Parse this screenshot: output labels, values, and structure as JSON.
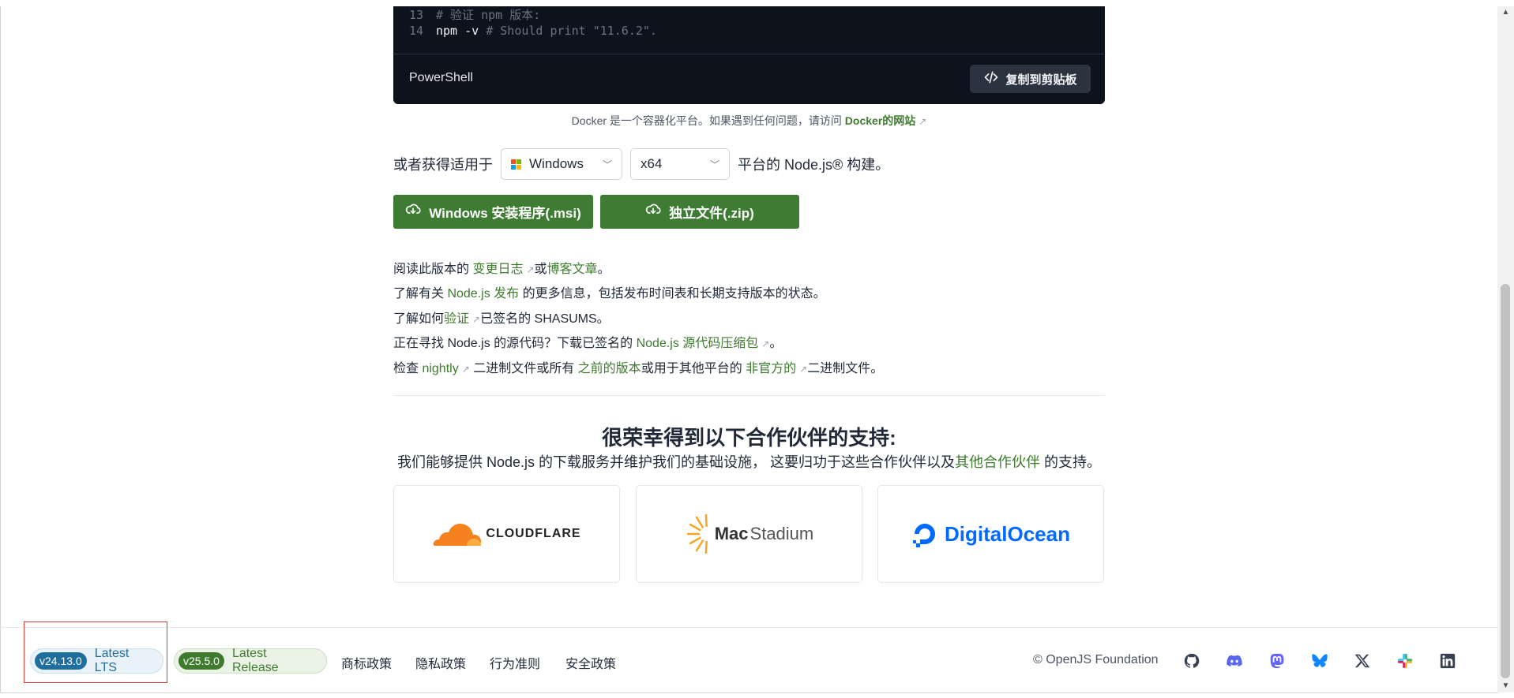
{
  "code": {
    "lines": [
      {
        "num": "13",
        "text": "# 验证 npm 版本:"
      },
      {
        "num": "14",
        "cmd": "npm -v",
        "comment": "# Should print \"11.6.2\"."
      }
    ],
    "language": "PowerShell",
    "copy_label": "复制到剪贴板"
  },
  "docker_note": {
    "text": "Docker 是一个容器化平台。如果遇到任何问题，请访问 ",
    "link": "Docker的网站"
  },
  "platform": {
    "prefix": "或者获得适用于",
    "os": "Windows",
    "arch": "x64",
    "suffix": "平台的 Node.js® 构建。"
  },
  "downloads": {
    "msi_label": "Windows 安装程序(.msi)",
    "zip_label": "独立文件(.zip)"
  },
  "info": {
    "l1": {
      "a": "阅读此版本的 ",
      "link1": "变更日志",
      "b": "或",
      "link2": "博客文章",
      "c": "。"
    },
    "l2": {
      "a": "了解有关 ",
      "link1": "Node.js 发布",
      "b": " 的更多信息，包括发布时间表和长期支持版本的状态。"
    },
    "l3": {
      "a": "了解如何",
      "link1": "验证",
      "b": "已签名的 SHASUMS。"
    },
    "l4": {
      "a": "正在寻找 Node.js 的源代码？下载已签名的 ",
      "link1": "Node.js 源代码压缩包",
      "b": "。"
    },
    "l5": {
      "a": "检查 ",
      "link1": "nightly",
      "b": " 二进制文件或所有 ",
      "link2": "之前的版本",
      "c": "或用于其他平台的 ",
      "link3": "非官方的",
      "d": "二进制文件。"
    }
  },
  "partners": {
    "title": "很荣幸得到以下合作伙伴的支持:",
    "subtitle_a": "我们能够提供 Node.js 的下载服务并维护我们的基础设施， 这要归功于这些合作伙伴以及",
    "subtitle_link": "其他合作伙伴",
    "subtitle_b": " 的支持。",
    "cloudflare": "CLOUDFLARE",
    "macstadium_mac": "Mac",
    "macstadium_stadium": "Stadium",
    "digitalocean": "DigitalOcean"
  },
  "footer": {
    "lts_version": "v24.13.0",
    "lts_label": "Latest LTS",
    "release_version": "v25.5.0",
    "release_label": "Latest Release",
    "links": [
      "商标政策",
      "隐私政策",
      "行为准则",
      "安全政策"
    ],
    "copyright": "© OpenJS Foundation",
    "social": [
      "github-icon",
      "discord-icon",
      "mastodon-icon",
      "bluesky-icon",
      "x-icon",
      "slack-icon",
      "linkedin-icon"
    ]
  },
  "colors": {
    "brand_green": "#3e7b2f",
    "lts_blue": "#1f6f9e",
    "code_bg": "#0d121c"
  }
}
